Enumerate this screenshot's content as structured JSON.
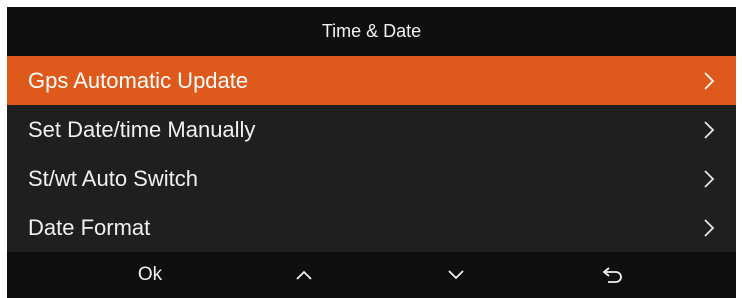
{
  "header": {
    "title": "Time & Date"
  },
  "menu": {
    "items": [
      {
        "label": "Gps Automatic Update",
        "selected": true,
        "icon": "chevron-right-icon"
      },
      {
        "label": "Set Date/time Manually",
        "selected": false,
        "icon": "chevron-right-icon"
      },
      {
        "label": "St/wt Auto Switch",
        "selected": false,
        "icon": "chevron-right-icon"
      },
      {
        "label": "Date Format",
        "selected": false,
        "icon": "chevron-right-icon"
      }
    ]
  },
  "footer": {
    "ok_label": "Ok",
    "up_icon": "chevron-up-icon",
    "down_icon": "chevron-down-icon",
    "back_icon": "back-arrow-icon"
  },
  "colors": {
    "accent": "#dd5a1c",
    "background": "#1f1f1f",
    "bar": "#0f0f0f",
    "text": "#f0f0f0"
  }
}
